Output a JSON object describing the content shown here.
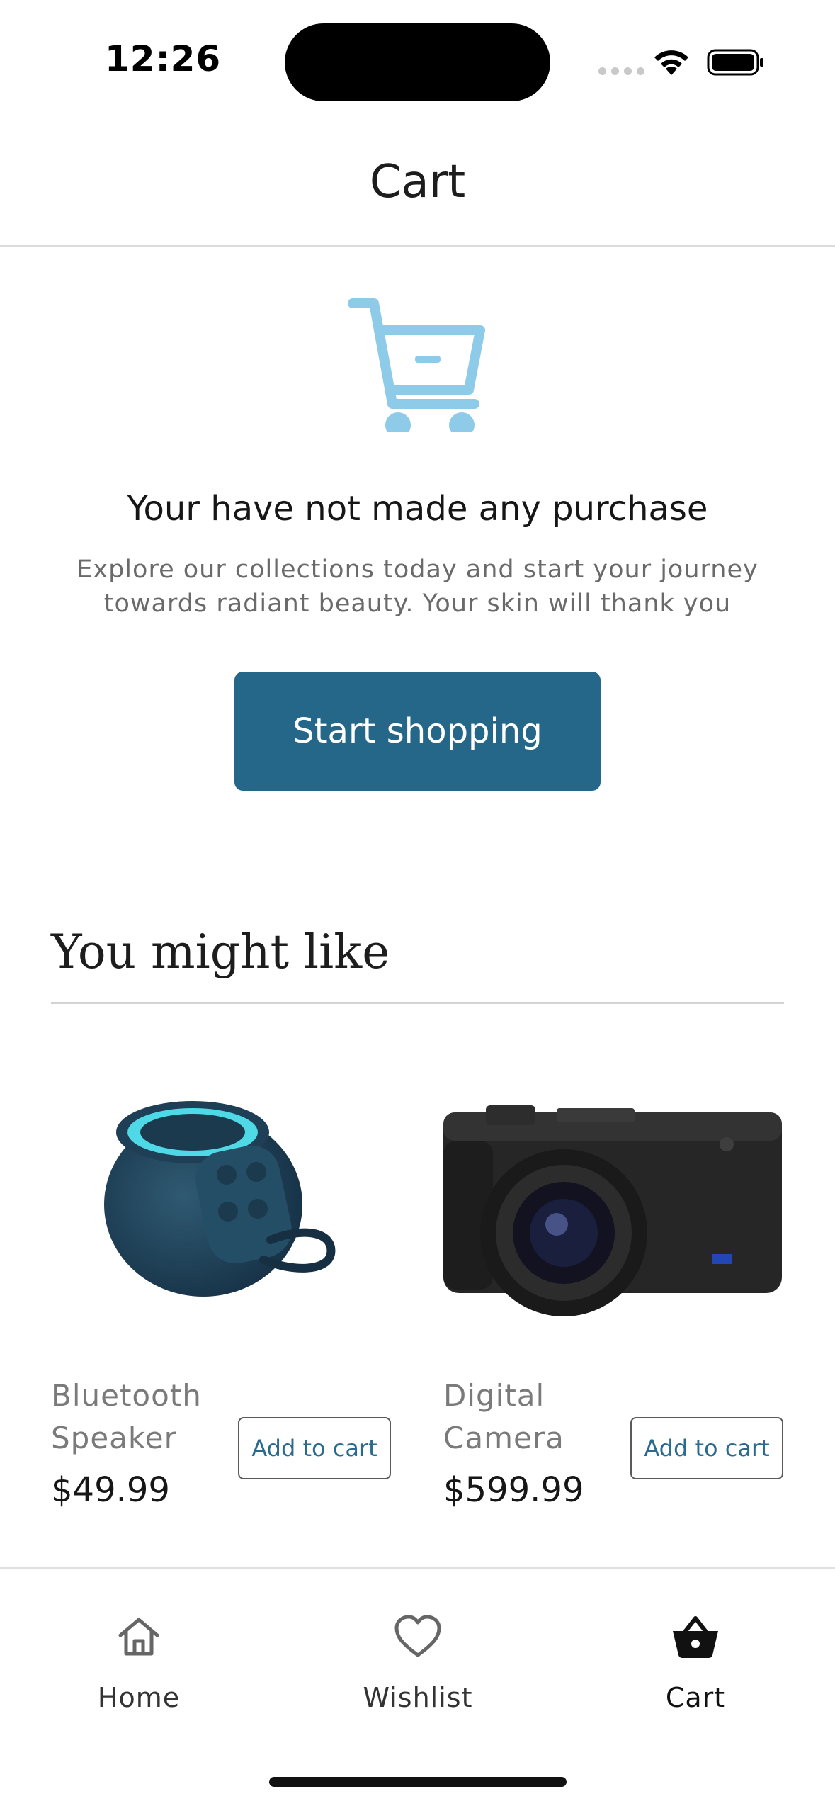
{
  "status_bar": {
    "time": "12:26"
  },
  "header": {
    "title": "Cart"
  },
  "empty_state": {
    "icon": "cart-minus-icon",
    "title": "Your have not made any purchase",
    "description": "Explore our collections today and start your journey towards radiant beauty. Your skin will thank you",
    "button_label": "Start shopping"
  },
  "recommendations": {
    "title": "You might like",
    "products": [
      {
        "name": "Bluetooth Speaker",
        "price": "$49.99",
        "button_label": "Add to cart"
      },
      {
        "name": "Digital Camera",
        "price": "$599.99",
        "button_label": "Add to cart"
      }
    ]
  },
  "bottom_nav": {
    "items": [
      {
        "label": "Home",
        "icon": "home-icon"
      },
      {
        "label": "Wishlist",
        "icon": "heart-icon"
      },
      {
        "label": "Cart",
        "icon": "basket-icon",
        "active": true
      }
    ]
  },
  "colors": {
    "accent": "#256789",
    "cart_icon": "#8dcbe8",
    "text_muted": "#6a6a6a"
  }
}
